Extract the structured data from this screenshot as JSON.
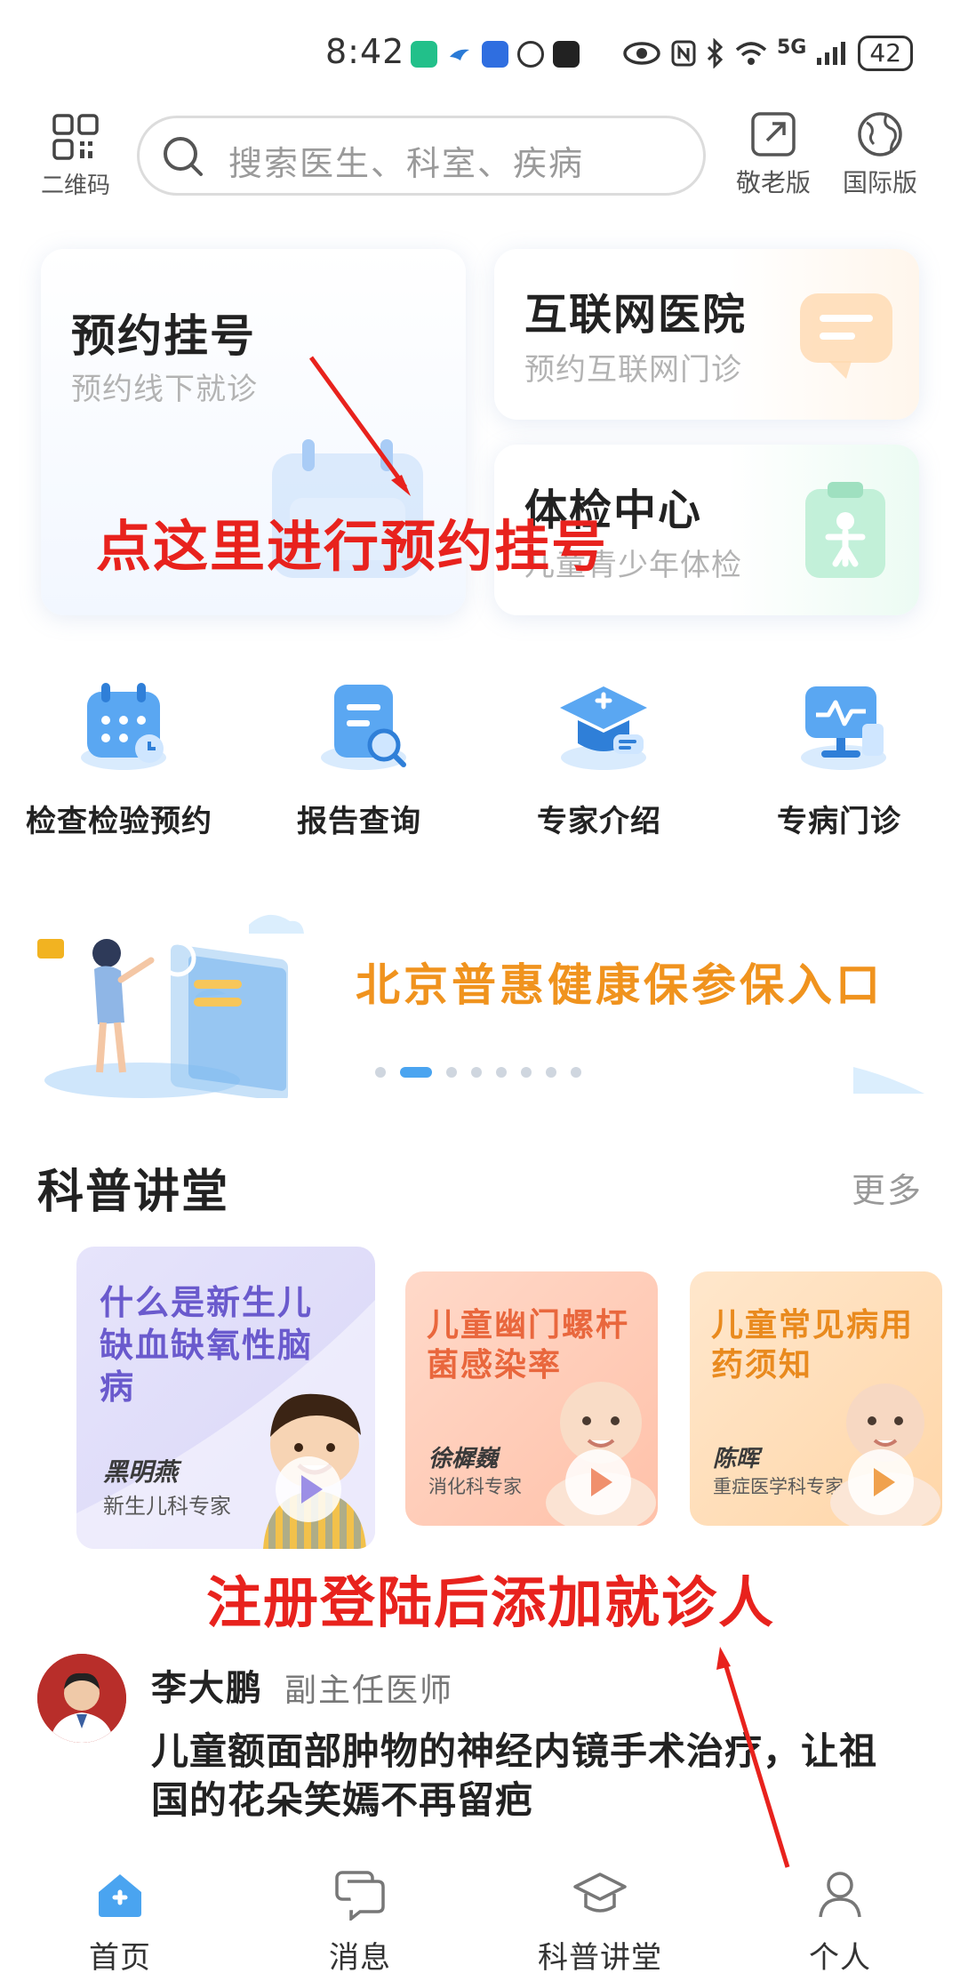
{
  "status_bar": {
    "time": "8:42",
    "network": "5G",
    "battery": "42"
  },
  "top_bar": {
    "qr_label": "二维码",
    "search_placeholder": "搜索医生、科室、疾病",
    "elder_label": "敬老版",
    "intl_label": "国际版"
  },
  "services": {
    "appointment": {
      "title": "预约挂号",
      "subtitle": "预约线下就诊"
    },
    "internet_hospital": {
      "title": "互联网医院",
      "subtitle": "预约互联网门诊"
    },
    "checkup": {
      "title": "体检中心",
      "subtitle": "儿童青少年体检"
    }
  },
  "quick_links": [
    {
      "label": "检查检验预约",
      "icon": "calendar-icon"
    },
    {
      "label": "报告查询",
      "icon": "report-search-icon"
    },
    {
      "label": "专家介绍",
      "icon": "graduation-cap-icon"
    },
    {
      "label": "专病门诊",
      "icon": "monitor-chart-icon"
    }
  ],
  "banner": {
    "text": "北京普惠健康保参保入口",
    "slides": 8,
    "active_slide": 2
  },
  "lecture_section": {
    "title": "科普讲堂",
    "more": "更多",
    "cards": [
      {
        "title": "什么是新生儿缺血缺氧性脑病",
        "doctor": "黑明燕",
        "role": "新生儿科专家"
      },
      {
        "title": "儿童幽门螺杆菌感染率",
        "doctor": "徐樨巍",
        "role": "消化科专家"
      },
      {
        "title": "儿童常见病用药须知",
        "doctor": "陈晖",
        "role": "重症医学科专家"
      }
    ]
  },
  "article": {
    "doctor_name": "李大鹏",
    "doctor_title": "副主任医师",
    "headline": "儿童额面部肿物的神经内镜手术治疗，让祖国的花朵笑嫣不再留疤"
  },
  "bottom_nav": [
    {
      "label": "首页",
      "icon": "home-icon",
      "active": true
    },
    {
      "label": "消息",
      "icon": "message-icon",
      "active": false
    },
    {
      "label": "科普讲堂",
      "icon": "graduation-cap-icon",
      "active": false
    },
    {
      "label": "个人",
      "icon": "person-icon",
      "active": false
    }
  ],
  "annotations": {
    "appointment_hint": "点这里进行预约挂号",
    "register_hint": "注册登陆后添加就诊人"
  },
  "colors": {
    "accent_blue": "#4aa4f0",
    "banner_orange": "#f0931e",
    "annotation_red": "#e8221d"
  }
}
